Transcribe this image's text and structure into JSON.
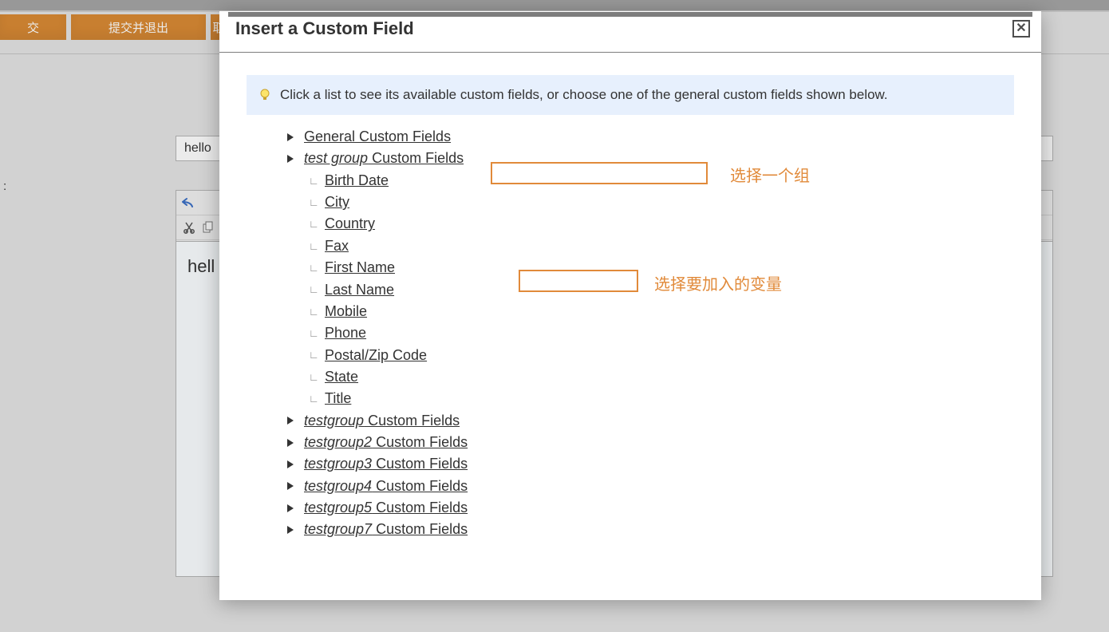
{
  "background": {
    "buttons": {
      "partial1": "交",
      "submitExit": "提交并退出",
      "partial2": "取"
    },
    "input_value": "hello",
    "label_colon": ":",
    "editor_text": "hell"
  },
  "modal": {
    "title": "Insert a Custom Field",
    "close_symbol": "✕",
    "info_text": "Click a list to see its available custom fields, or choose one of the general custom fields shown below.",
    "tree": {
      "general": {
        "label": "General Custom Fields"
      },
      "test_group": {
        "em": "test group",
        "suffix": " Custom Fields",
        "children": [
          "Birth Date",
          "City",
          "Country",
          "Fax",
          "First Name",
          "Last Name",
          "Mobile",
          "Phone",
          "Postal/Zip Code",
          "State",
          "Title"
        ]
      },
      "other_groups": [
        {
          "em": "testgroup",
          "suffix": " Custom Fields"
        },
        {
          "em": "testgroup2",
          "suffix": " Custom Fields"
        },
        {
          "em": "testgroup3",
          "suffix": " Custom Fields"
        },
        {
          "em": "testgroup4",
          "suffix": " Custom Fields"
        },
        {
          "em": "testgroup5",
          "suffix": " Custom Fields"
        },
        {
          "em": "testgroup7",
          "suffix": " Custom Fields"
        }
      ]
    }
  },
  "annotations": {
    "select_group": "选择一个组",
    "select_variable": "选择要加入的变量"
  }
}
